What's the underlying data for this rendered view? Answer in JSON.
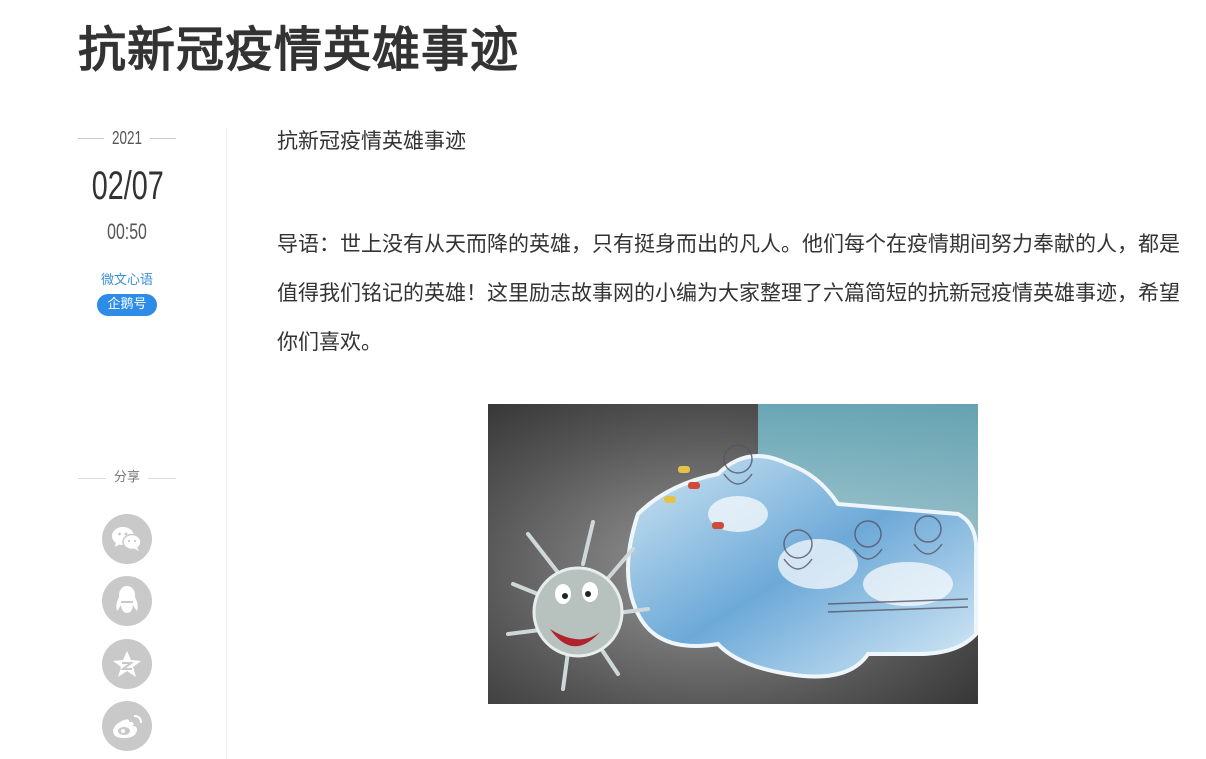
{
  "article": {
    "title": "抗新冠疫情英雄事迹",
    "subtitle": "抗新冠疫情英雄事迹",
    "intro": "导语：世上没有从天而降的英雄，只有挺身而出的凡人。他们每个在疫情期间努力奉献的人，都是值得我们铭记的英雄！这里励志故事网的小编为大家整理了六篇简短的抗新冠疫情英雄事迹，希望你们喜欢。"
  },
  "meta": {
    "year": "2021",
    "date": "02/07",
    "time": "00:50",
    "author": "微文心语",
    "badge": "企鹅号"
  },
  "share": {
    "label": "分享",
    "buttons": [
      {
        "icon": "wechat-icon"
      },
      {
        "icon": "qq-icon"
      },
      {
        "icon": "qzone-icon"
      },
      {
        "icon": "weibo-icon"
      }
    ]
  },
  "colors": {
    "accent": "#2d8ce8",
    "share_button": "#c9c9c9"
  }
}
